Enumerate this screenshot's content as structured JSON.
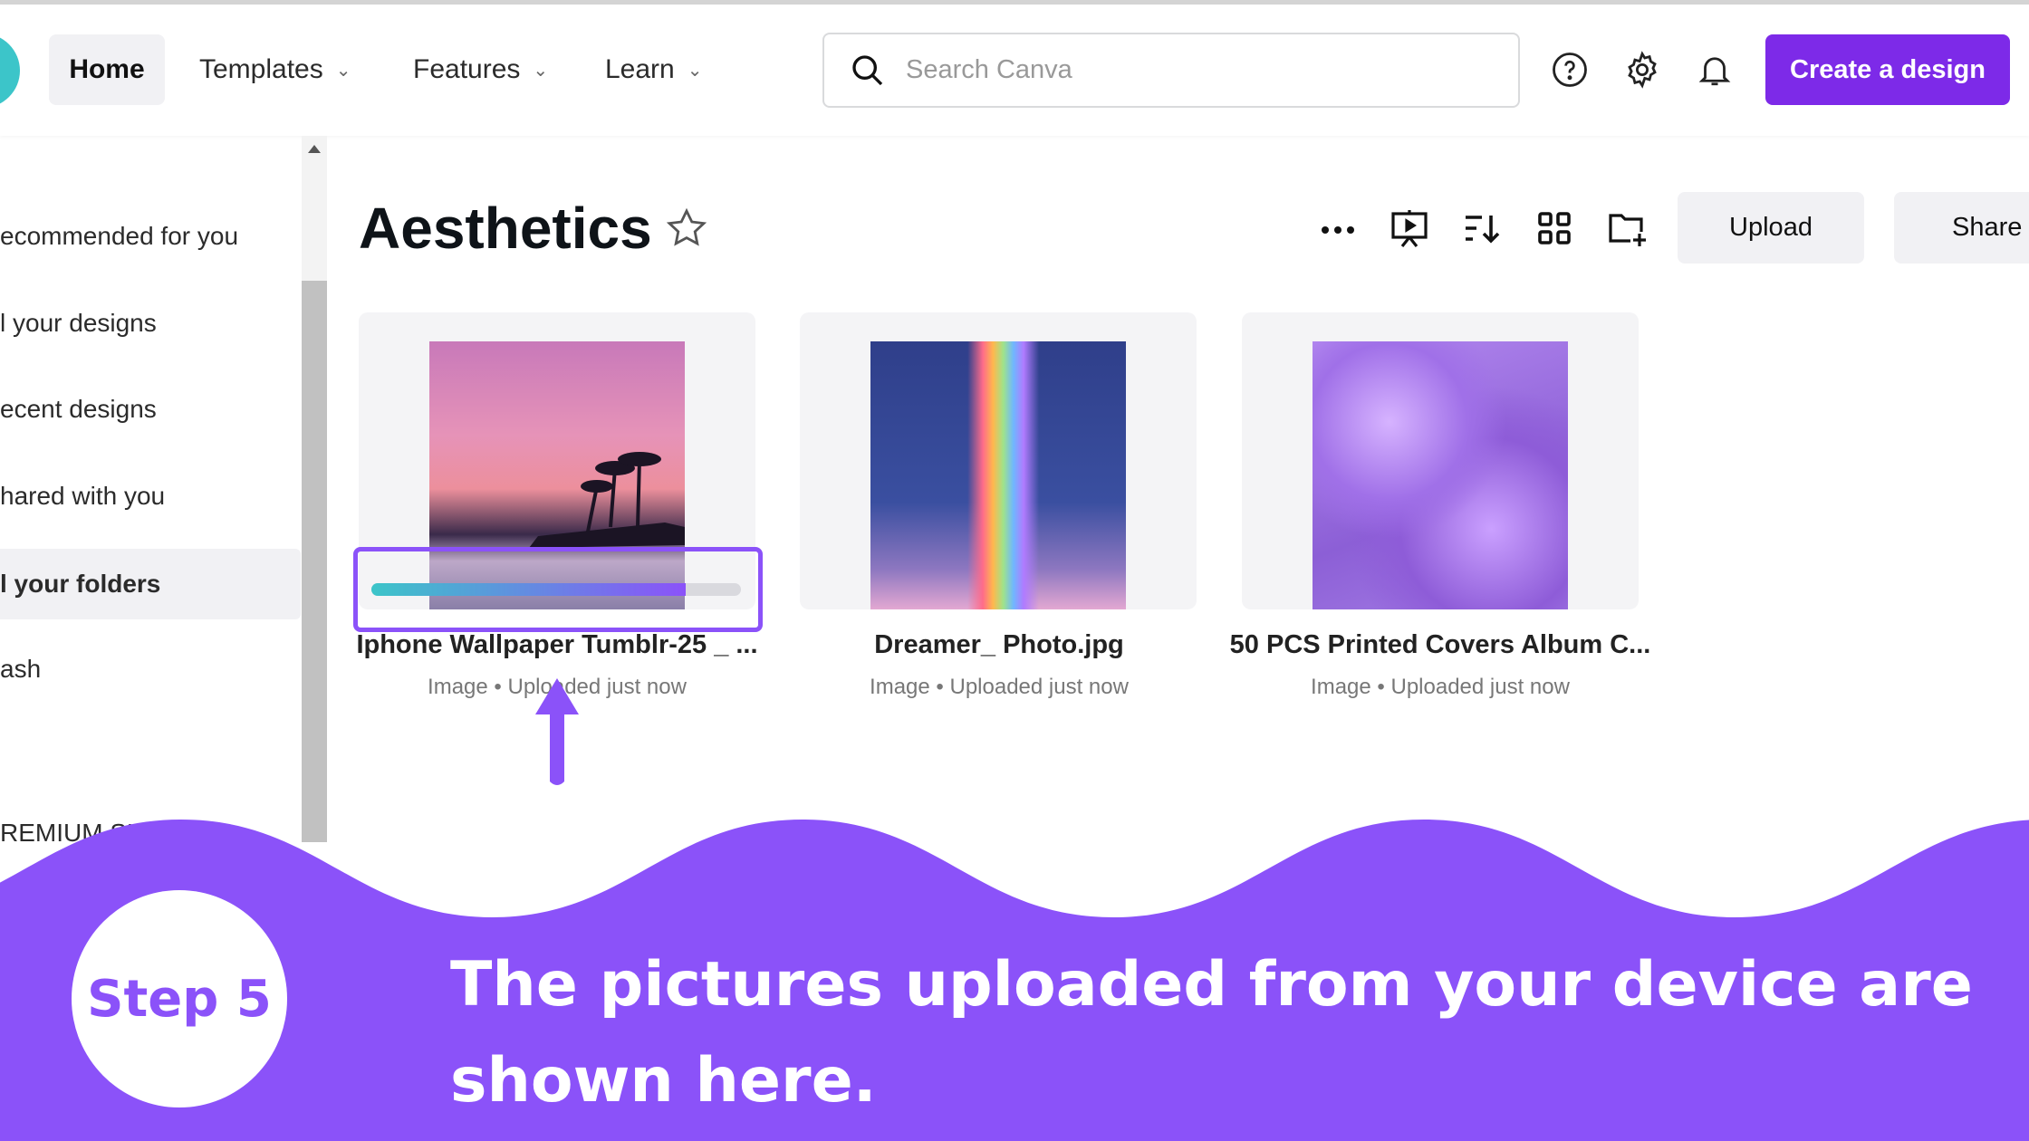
{
  "header": {
    "nav": [
      {
        "label": "Home"
      },
      {
        "label": "Templates"
      },
      {
        "label": "Features"
      },
      {
        "label": "Learn"
      }
    ],
    "search_placeholder": "Search Canva",
    "create_label": "Create a design",
    "icons": [
      "help-icon",
      "settings-icon",
      "notification-bell-icon"
    ]
  },
  "sidebar": {
    "items": [
      {
        "label": "ecommended for you"
      },
      {
        "label": "l your designs"
      },
      {
        "label": "ecent designs"
      },
      {
        "label": "hared with you"
      },
      {
        "label": "l your folders",
        "selected": true
      },
      {
        "label": "ash"
      },
      {
        "label": "REMIUM SU"
      }
    ]
  },
  "folder": {
    "title": "Aesthetics",
    "upload_label": "Upload",
    "share_label": "Share",
    "items": [
      {
        "name": "Iphone Wallpaper Tumblr-25 _ ...",
        "meta": "Image • Uploaded just now",
        "upload_progress": 0.85
      },
      {
        "name": "Dreamer_ Photo.jpg",
        "meta": "Image • Uploaded just now"
      },
      {
        "name": "50 PCS Printed Covers Album C...",
        "meta": "Image • Uploaded just now"
      }
    ]
  },
  "overlay": {
    "step": "Step 5",
    "caption": "The pictures uploaded from your device are shown here.",
    "accent": "#8b52f9"
  },
  "colors": {
    "brand": "#7d2ae8",
    "logo": "#3cc5c9"
  }
}
